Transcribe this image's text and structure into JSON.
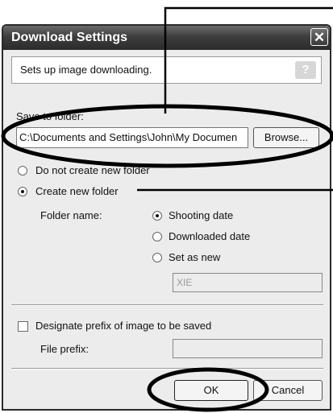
{
  "window": {
    "title": "Download Settings",
    "close_glyph": "✕"
  },
  "header": {
    "description": "Sets up image downloading.",
    "help_label": "?"
  },
  "save_to_folder": {
    "label": "Save to folder:",
    "path_value": "C:\\Documents and Settings\\John\\My Documen",
    "browse_label": "Browse..."
  },
  "folder_options": {
    "do_not_create_label": "Do not create new folder",
    "create_new_label": "Create new folder",
    "selected": "create_new"
  },
  "folder_name": {
    "label": "Folder name:",
    "shooting_date_label": "Shooting date",
    "downloaded_date_label": "Downloaded date",
    "set_as_new_label": "Set as new",
    "selected": "shooting_date",
    "new_name_value": "XIE"
  },
  "prefix": {
    "designate_label": "Designate prefix of image to be saved",
    "checked": false,
    "file_prefix_label": "File prefix:",
    "file_prefix_value": ""
  },
  "buttons": {
    "ok_label": "OK",
    "cancel_label": "Cancel"
  },
  "annotations": {
    "color": "#000000",
    "circled_items": [
      "save-folder-row",
      "ok-button"
    ],
    "callout_lines": [
      "save-to-folder",
      "create-new-folder"
    ]
  }
}
